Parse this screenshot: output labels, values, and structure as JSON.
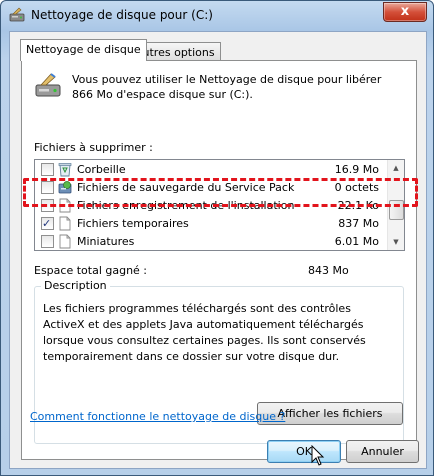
{
  "window": {
    "title": "Nettoyage de disque pour  (C:)",
    "close_symbol": "x"
  },
  "tabs": [
    {
      "label": "Nettoyage de disque"
    },
    {
      "label": "Autres options"
    }
  ],
  "info": {
    "text": "Vous pouvez utiliser le Nettoyage de disque pour libérer 866 Mo d'espace disque sur  (C:)."
  },
  "files_label": "Fichiers à supprimer :",
  "file_list": [
    {
      "name": "Corbeille",
      "size": "16.9 Mo",
      "checked": false,
      "icon": "recycle-bin-icon"
    },
    {
      "name": "Fichiers de sauvegarde du Service Pack",
      "size": "0 octets",
      "checked": false,
      "icon": "service-pack-icon"
    },
    {
      "name": "Fichiers enregistrement de l'installation",
      "size": "22.1 Ko",
      "checked": false,
      "icon": "file-icon"
    },
    {
      "name": "Fichiers temporaires",
      "size": "837 Mo",
      "checked": true,
      "icon": "file-icon"
    },
    {
      "name": "Miniatures",
      "size": "6.01 Mo",
      "checked": false,
      "icon": "file-icon"
    }
  ],
  "total": {
    "label": "Espace total gagné :",
    "value": "843 Mo"
  },
  "description": {
    "title": "Description",
    "text": "Les fichiers programmes téléchargés sont des contrôles ActiveX et des applets Java automatiquement téléchargés lorsque vous consultez certaines pages. Ils sont conservés temporairement dans ce dossier sur votre disque dur."
  },
  "buttons": {
    "view_files": "Afficher les fichiers",
    "ok": "OK",
    "cancel": "Annuler"
  },
  "help_link": "Comment fonctionne le nettoyage de disque ?",
  "colors": {
    "highlight_dash": "#e2141c",
    "link": "#0066cc"
  }
}
